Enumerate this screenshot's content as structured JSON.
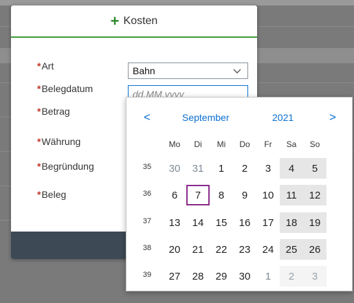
{
  "dialog": {
    "title": "Kosten",
    "required_marker": "*",
    "fields": [
      {
        "label": "Art"
      },
      {
        "label": "Belegdatum"
      },
      {
        "label": "Betrag"
      },
      {
        "label": "Währung"
      },
      {
        "label": "Begründung"
      },
      {
        "label": "Beleg"
      }
    ],
    "art_select": {
      "value": "Bahn"
    },
    "belegdatum": {
      "placeholder": "dd.MM.yyyy"
    }
  },
  "calendar": {
    "prev_symbol": "<",
    "next_symbol": ">",
    "month": "September",
    "year": "2021",
    "weekdays": [
      "Mo",
      "Di",
      "Mi",
      "Do",
      "Fr",
      "Sa",
      "So"
    ],
    "weeks": [
      {
        "number": "35",
        "days": [
          "30",
          "31",
          "1",
          "2",
          "3",
          "4",
          "5"
        ]
      },
      {
        "number": "36",
        "days": [
          "6",
          "7",
          "8",
          "9",
          "10",
          "11",
          "12"
        ]
      },
      {
        "number": "37",
        "days": [
          "13",
          "14",
          "15",
          "16",
          "17",
          "18",
          "19"
        ]
      },
      {
        "number": "38",
        "days": [
          "20",
          "21",
          "22",
          "23",
          "24",
          "25",
          "26"
        ]
      },
      {
        "number": "39",
        "days": [
          "27",
          "28",
          "29",
          "30",
          "1",
          "2",
          "3"
        ]
      }
    ],
    "outside_month": [
      [
        0,
        0
      ],
      [
        0,
        1
      ],
      [
        4,
        4
      ],
      [
        4,
        5
      ],
      [
        4,
        6
      ]
    ],
    "today": [
      1,
      1
    ]
  },
  "colors": {
    "accent": "#0a6ed1",
    "header_underline": "#3a9a3a",
    "required": "#c0392b",
    "today_border": "#8a2a8a",
    "footer": "#3d4a55"
  },
  "icons": {
    "add": "plus-icon",
    "dropdown": "chevron-down-icon",
    "calendar": "calendar-icon"
  }
}
